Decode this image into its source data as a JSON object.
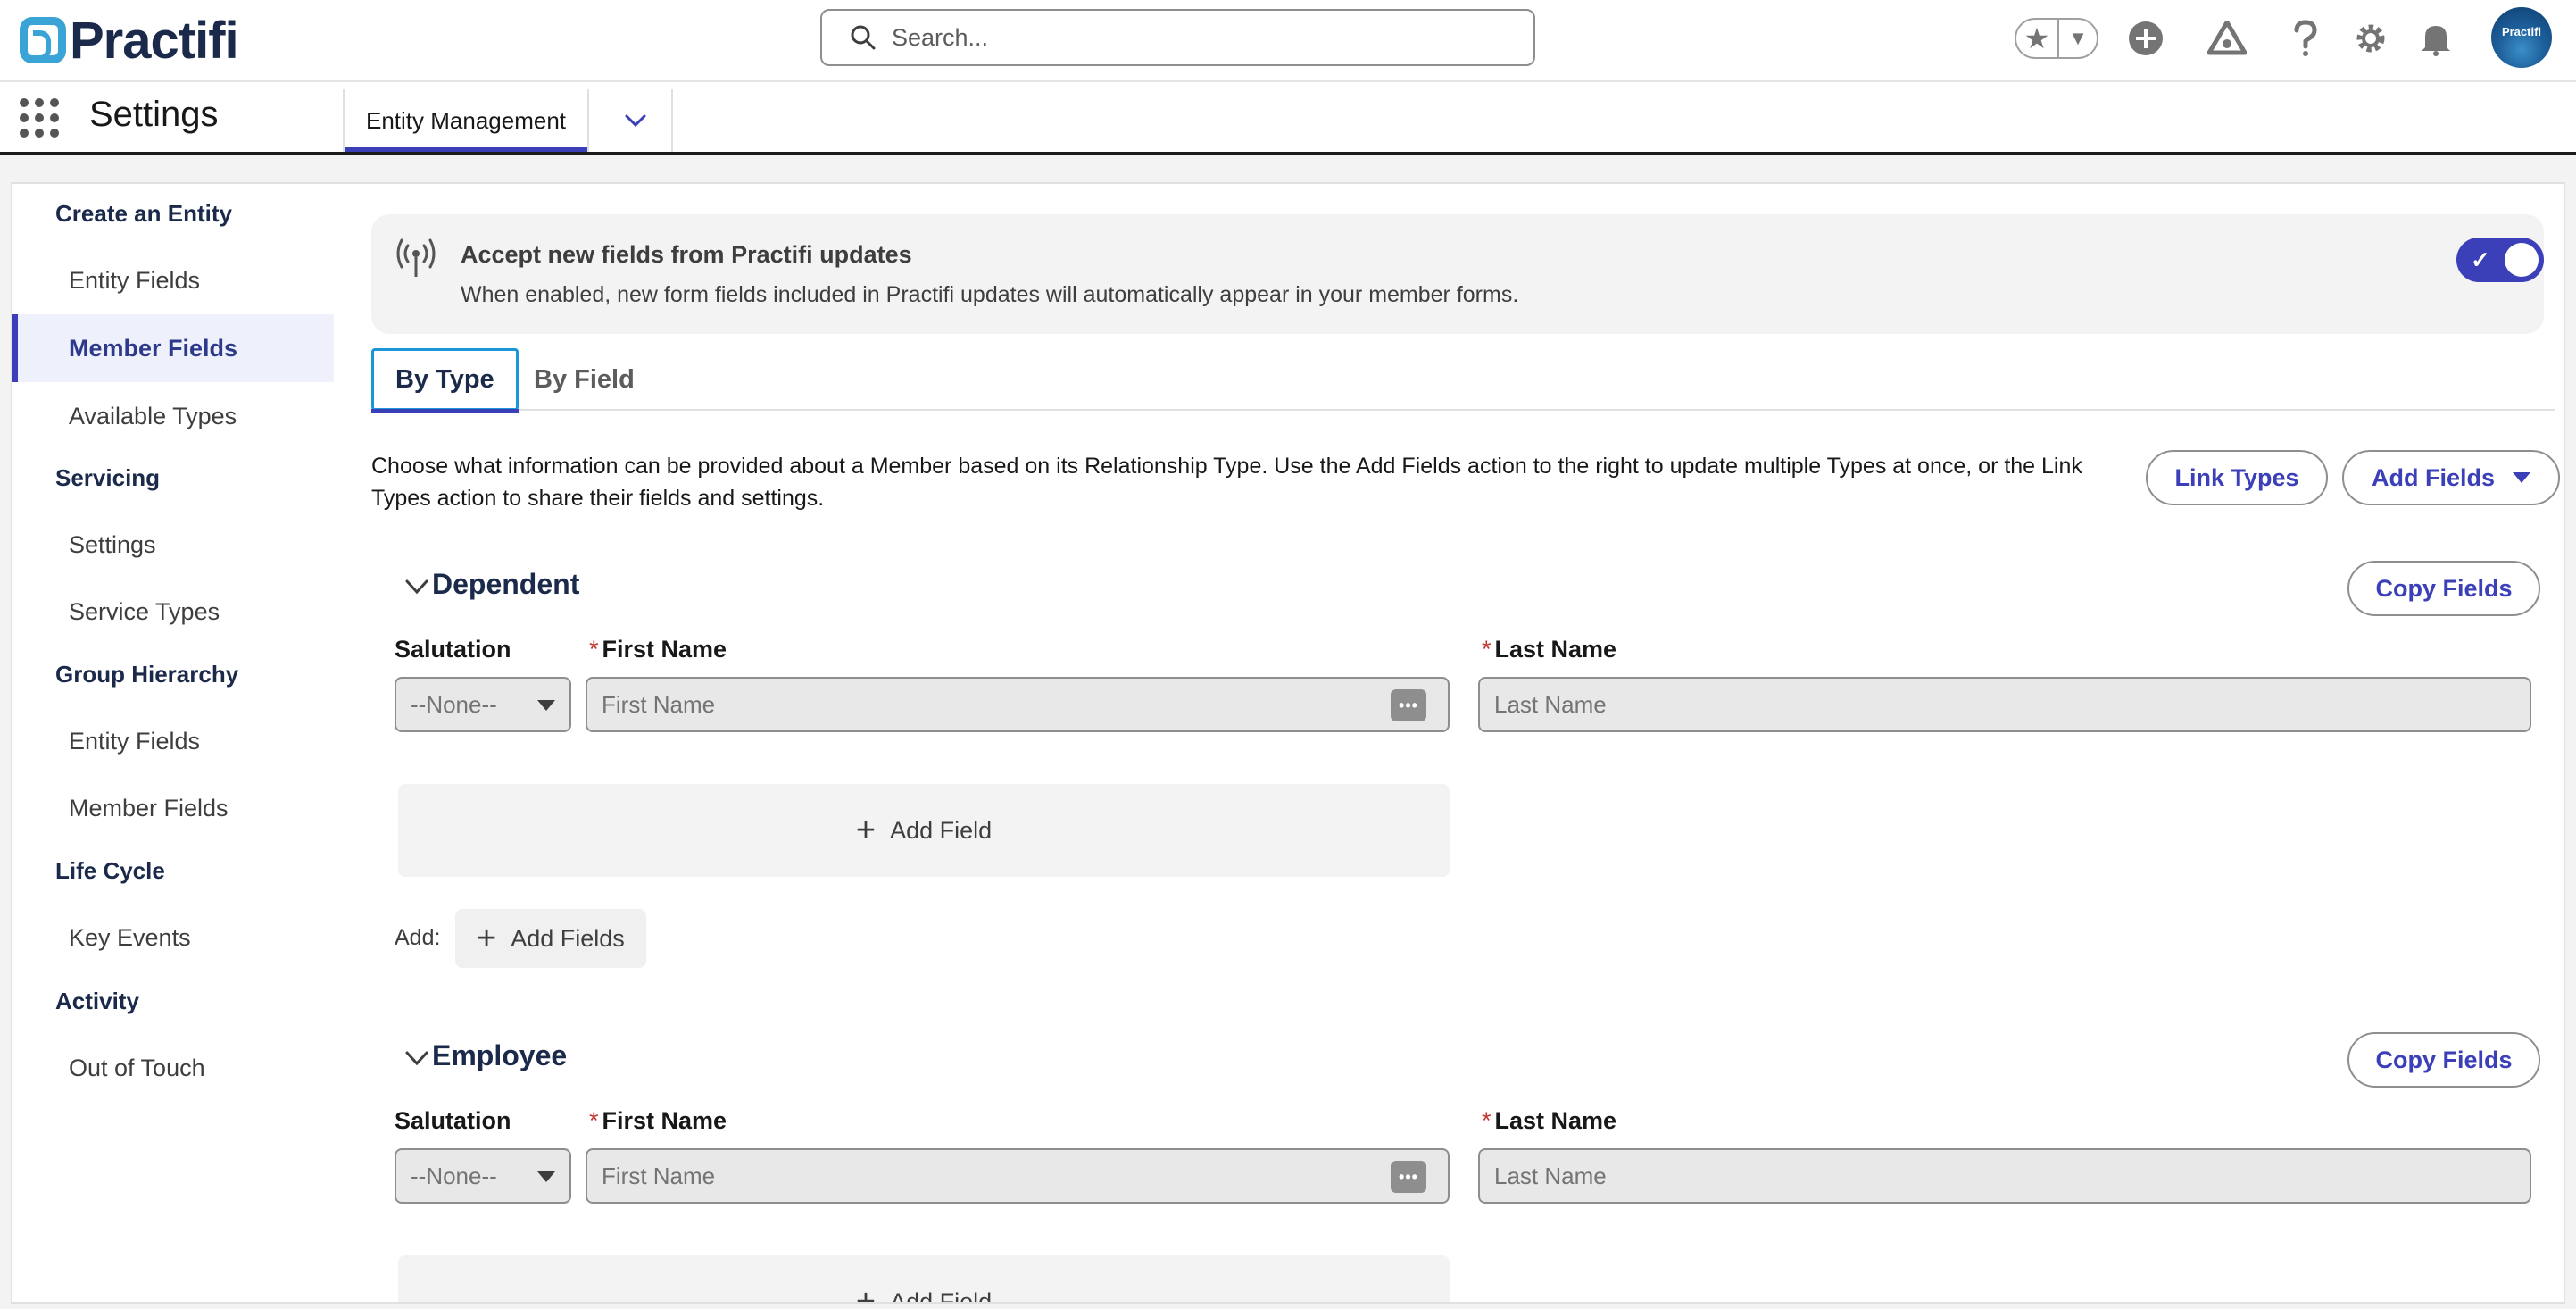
{
  "header": {
    "logo_text": "Practifi",
    "search_placeholder": "Search...",
    "avatar_text": "Practifi"
  },
  "navbar": {
    "app_name": "Settings",
    "tab_label": "Entity Management"
  },
  "sidebar": {
    "groups": [
      {
        "heading": "Create an Entity",
        "items": [
          "Entity Fields",
          "Member Fields",
          "Available Types"
        ]
      },
      {
        "heading": "Servicing",
        "items": [
          "Settings",
          "Service Types"
        ]
      },
      {
        "heading": "Group Hierarchy",
        "items": [
          "Entity Fields",
          "Member Fields"
        ]
      },
      {
        "heading": "Life Cycle",
        "items": [
          "Key Events"
        ]
      },
      {
        "heading": "Activity",
        "items": [
          "Out of Touch"
        ]
      }
    ],
    "active_item": "Member Fields"
  },
  "banner": {
    "title": "Accept new fields from Practifi updates",
    "description": "When enabled, new form fields included in Practifi updates will automatically appear in your member forms.",
    "toggle_on": true
  },
  "tabs": [
    {
      "label": "By Type",
      "active": true
    },
    {
      "label": "By Field",
      "active": false
    }
  ],
  "intro": "Choose what information can be provided about a Member based on its Relationship Type. Use the Add Fields action to the right to update multiple Types at once, or the Link Types action to share their fields and settings.",
  "actions": {
    "link_types": "Link Types",
    "add_fields": "Add Fields"
  },
  "sections": [
    {
      "title": "Dependent",
      "copy_label": "Copy Fields",
      "salutation_label": "Salutation",
      "salutation_value": "--None--",
      "first_name_label": "First Name",
      "first_name_placeholder": "First Name",
      "last_name_label": "Last Name",
      "last_name_placeholder": "Last Name",
      "add_field_label": "Add Field",
      "add_prefix": "Add:",
      "add_fields_label": "Add Fields",
      "required_marker": "*"
    },
    {
      "title": "Employee",
      "copy_label": "Copy Fields",
      "salutation_label": "Salutation",
      "salutation_value": "--None--",
      "first_name_label": "First Name",
      "first_name_placeholder": "First Name",
      "last_name_label": "Last Name",
      "last_name_placeholder": "Last Name",
      "add_field_label": "Add Field",
      "required_marker": "*"
    }
  ],
  "colors": {
    "brand_blue": "#3b3fb8",
    "logo_cyan": "#3aa4d6",
    "required_red": "#c23934"
  }
}
